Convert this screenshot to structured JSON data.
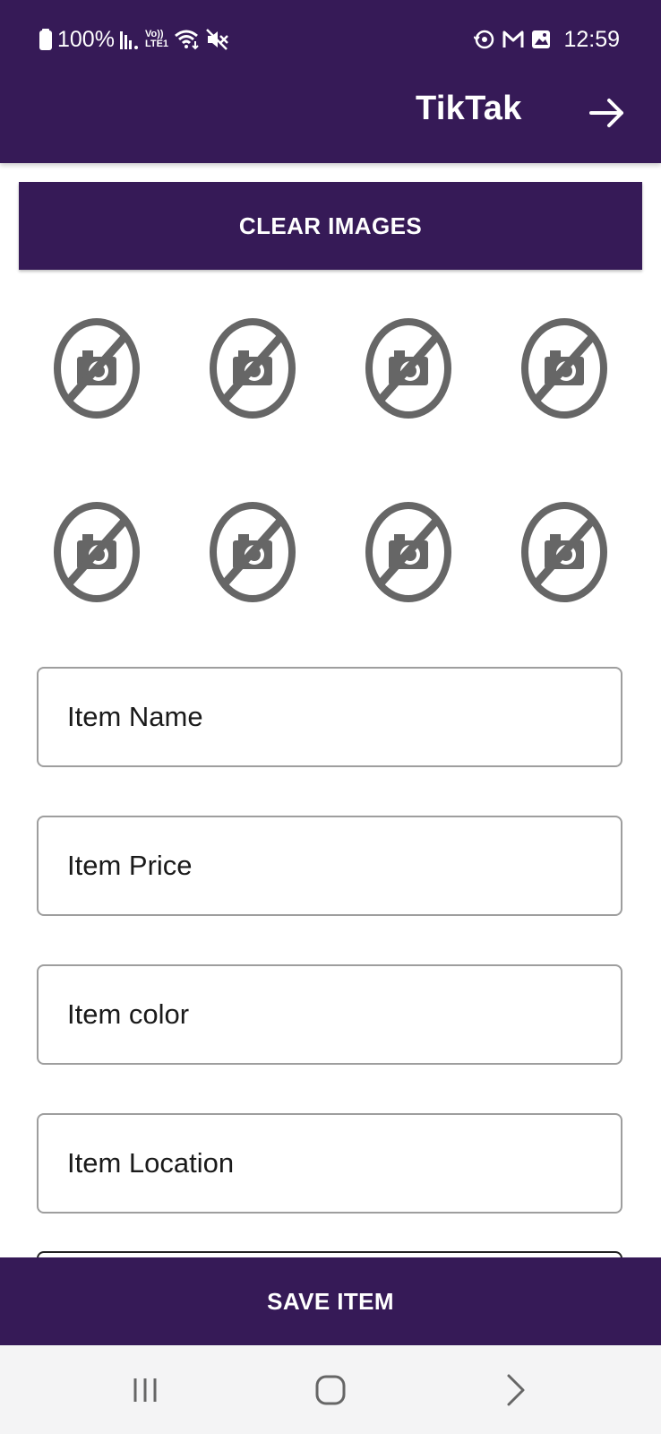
{
  "status_bar": {
    "battery": "100%",
    "time": "12:59",
    "volte_label_top": "Vo))",
    "volte_label_bottom": "LTE1",
    "icons": [
      "battery-icon",
      "signal-icon",
      "volte-icon",
      "wifi-icon",
      "mute-icon",
      "sync-icon",
      "gmail-icon",
      "gallery-icon"
    ]
  },
  "app_bar": {
    "title": "TikTak",
    "forward_icon": "arrow-right-icon"
  },
  "clear_images": {
    "label": "CLEAR IMAGES"
  },
  "image_slots": {
    "count": 8,
    "icon": "no-photo-icon"
  },
  "form": {
    "fields": [
      {
        "placeholder": "Item Name"
      },
      {
        "placeholder": "Item Price"
      },
      {
        "placeholder": "Item color"
      },
      {
        "placeholder": "Item Location"
      }
    ]
  },
  "save_item": {
    "label": "SAVE ITEM"
  },
  "nav_bar": {
    "icons": [
      "recents-icon",
      "home-icon",
      "back-icon"
    ]
  },
  "colors": {
    "primary": "#361a57",
    "on_primary": "#ffffff",
    "icon_gray": "#666666",
    "field_border": "#9e9e9e",
    "nav_background": "#f4f4f5"
  }
}
